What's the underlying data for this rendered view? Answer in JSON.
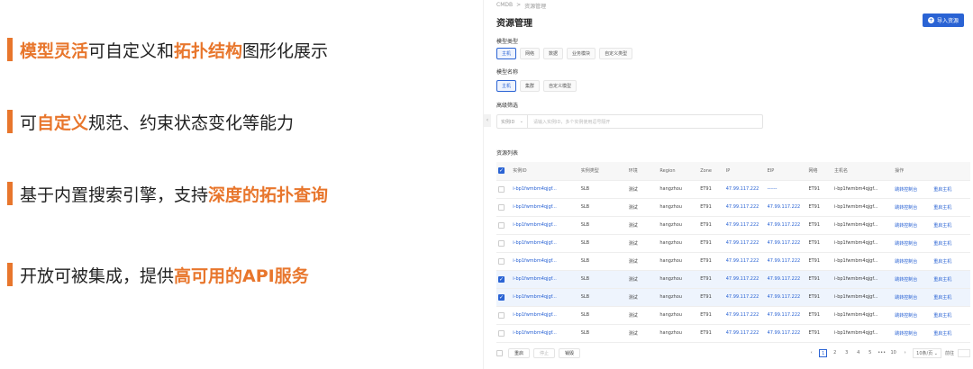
{
  "slide": {
    "bullets": [
      {
        "parts": [
          {
            "t": "模型灵活",
            "hl": true
          },
          {
            "t": "可自定义和",
            "hl": false
          },
          {
            "t": "拓扑结构",
            "hl": true
          },
          {
            "t": "图形化展示",
            "hl": false
          }
        ]
      },
      {
        "parts": [
          {
            "t": "可",
            "hl": false
          },
          {
            "t": "自定义",
            "hl": true
          },
          {
            "t": "规范、约束状态变化等能力",
            "hl": false
          }
        ]
      },
      {
        "parts": [
          {
            "t": "基于内置搜索引擎，支持",
            "hl": false
          },
          {
            "t": "深度的拓扑查询",
            "hl": true
          }
        ]
      },
      {
        "parts": [
          {
            "t": "开放可被集成，提供",
            "hl": false
          },
          {
            "t": "高可用的API服务",
            "hl": true
          }
        ]
      }
    ]
  },
  "panel": {
    "breadcrumb": [
      "CMDB",
      ">",
      "资源管理"
    ],
    "title": "资源管理",
    "import_button": "导入资源",
    "model_type_label": "模型类型",
    "model_types": [
      "主机",
      "网络",
      "数据",
      "业务模块",
      "自定义类型"
    ],
    "model_name_label": "模型名称",
    "model_names": [
      "主机",
      "集群",
      "自定义模型"
    ],
    "advanced_filter_label": "高级筛选",
    "filter_select": "实例ID",
    "filter_placeholder": "请输入实例ID，多个实例使用逗号隔开",
    "list_label": "资源列表",
    "columns": [
      "实例ID",
      "实例类型",
      "环境",
      "Region",
      "Zone",
      "IP",
      "EIP",
      "网络",
      "主机名",
      "操作"
    ],
    "rows": [
      {
        "id": "i-bp1fwmbm4qjgf...",
        "type": "SLB",
        "env": "测试",
        "region": "hangzhou",
        "zone": "ET91",
        "ip": "47.99.117.222",
        "eip": "------",
        "net": "ET91",
        "host": "i-bp1fwmbm4qjgf...",
        "op1": "跳转控制台",
        "op2": "重启主机",
        "checked": false
      },
      {
        "id": "i-bp1fwmbm4qjgf...",
        "type": "SLB",
        "env": "测试",
        "region": "hangzhou",
        "zone": "ET91",
        "ip": "47.99.117.222",
        "eip": "47.99.117.222",
        "net": "ET91",
        "host": "i-bp1fwmbm4qjgf...",
        "op1": "跳转控制台",
        "op2": "重启主机",
        "checked": false
      },
      {
        "id": "i-bp1fwmbm4qjgf...",
        "type": "SLB",
        "env": "测试",
        "region": "hangzhou",
        "zone": "ET91",
        "ip": "47.99.117.222",
        "eip": "47.99.117.222",
        "net": "ET91",
        "host": "i-bp1fwmbm4qjgf...",
        "op1": "跳转控制台",
        "op2": "重启主机",
        "checked": false
      },
      {
        "id": "i-bp1fwmbm4qjgf...",
        "type": "SLB",
        "env": "测试",
        "region": "hangzhou",
        "zone": "ET91",
        "ip": "47.99.117.222",
        "eip": "47.99.117.222",
        "net": "ET91",
        "host": "i-bp1fwmbm4qjgf...",
        "op1": "跳转控制台",
        "op2": "重启主机",
        "checked": false
      },
      {
        "id": "i-bp1fwmbm4qjgf...",
        "type": "SLB",
        "env": "测试",
        "region": "hangzhou",
        "zone": "ET91",
        "ip": "47.99.117.222",
        "eip": "47.99.117.222",
        "net": "ET91",
        "host": "i-bp1fwmbm4qjgf...",
        "op1": "跳转控制台",
        "op2": "重启主机",
        "checked": false
      },
      {
        "id": "i-bp1fwmbm4qjgf...",
        "type": "SLB",
        "env": "测试",
        "region": "hangzhou",
        "zone": "ET91",
        "ip": "47.99.117.222",
        "eip": "47.99.117.222",
        "net": "ET91",
        "host": "i-bp1fwmbm4qjgf...",
        "op1": "跳转控制台",
        "op2": "重启主机",
        "checked": true
      },
      {
        "id": "i-bp1fwmbm4qjgf...",
        "type": "SLB",
        "env": "测试",
        "region": "hangzhou",
        "zone": "ET91",
        "ip": "47.99.117.222",
        "eip": "47.99.117.222",
        "net": "ET91",
        "host": "i-bp1fwmbm4qjgf...",
        "op1": "跳转控制台",
        "op2": "重启主机",
        "checked": true
      },
      {
        "id": "i-bp1fwmbm4qjgf...",
        "type": "SLB",
        "env": "测试",
        "region": "hangzhou",
        "zone": "ET91",
        "ip": "47.99.117.222",
        "eip": "47.99.117.222",
        "net": "ET91",
        "host": "i-bp1fwmbm4qjgf...",
        "op1": "跳转控制台",
        "op2": "重启主机",
        "checked": false
      },
      {
        "id": "i-bp1fwmbm4qjgf...",
        "type": "SLB",
        "env": "测试",
        "region": "hangzhou",
        "zone": "ET91",
        "ip": "47.99.117.222",
        "eip": "47.99.117.222",
        "net": "ET91",
        "host": "i-bp1fwmbm4qjgf...",
        "op1": "跳转控制台",
        "op2": "重启主机",
        "checked": false
      }
    ],
    "footer": {
      "buttons": [
        "重启",
        "停止",
        "销毁"
      ],
      "pages": [
        "1",
        "2",
        "3",
        "4",
        "5",
        "•••",
        "10"
      ],
      "page_size": "10条/页",
      "goto": "前往"
    }
  },
  "colors": {
    "accent": "#e8762c",
    "primary": "#2a63d4"
  }
}
